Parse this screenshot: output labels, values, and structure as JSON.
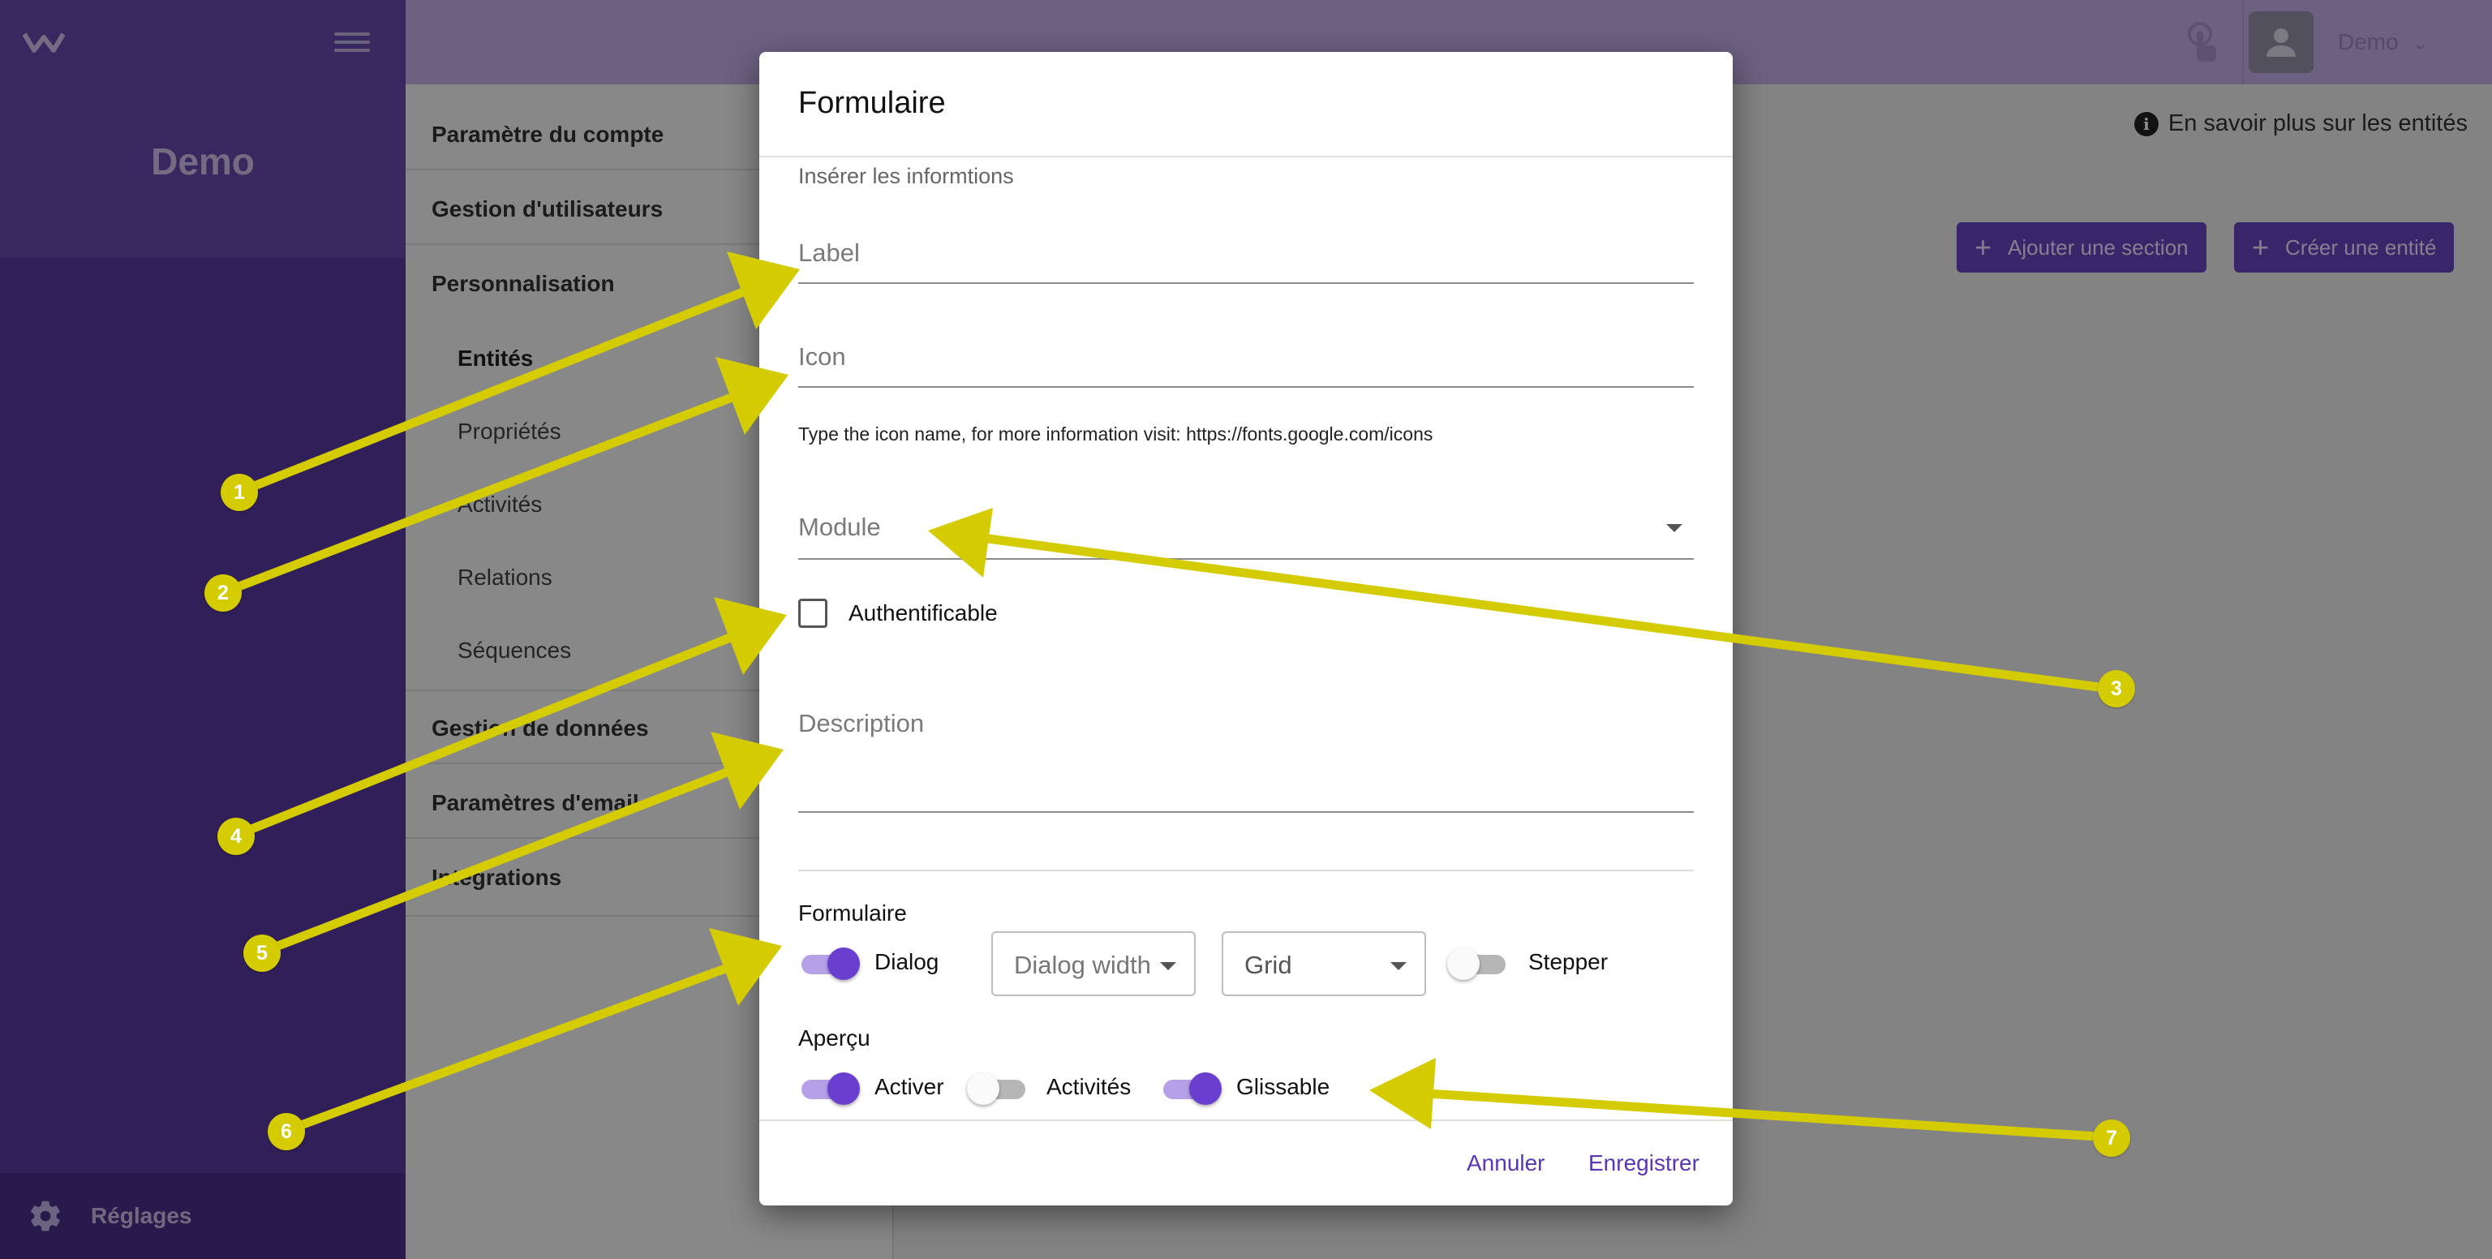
{
  "sidebar": {
    "brand": "Demo",
    "footer_label": "Réglages"
  },
  "topbar": {
    "user_name": "Demo"
  },
  "settings_nav": {
    "account": "Paramètre du compte",
    "users": "Gestion d'utilisateurs",
    "customization": "Personnalisation",
    "entities": "Entités",
    "properties": "Propriétés",
    "activities": "Activités",
    "relations": "Relations",
    "sequences": "Séquences",
    "data": "Gestion de données",
    "email": "Paramètres d'email",
    "integrations": "Intégrations"
  },
  "content": {
    "info_link": "En savoir plus sur les entités",
    "add_section": "Ajouter une section",
    "create_entity": "Créer une entité"
  },
  "dialog": {
    "title": "Formulaire",
    "subtitle": "Insérer les informtions",
    "label_placeholder": "Label",
    "icon_placeholder": "Icon",
    "icon_hint": "Type the icon name, for more information visit: https://fonts.google.com/icons",
    "module_placeholder": "Module",
    "authentificable_label": "Authentificable",
    "authentificable_checked": false,
    "description_placeholder": "Description",
    "form_section": {
      "label": "Formulaire",
      "dialog_label": "Dialog",
      "dialog_on": true,
      "dialog_width_placeholder": "Dialog width",
      "layout_value": "Grid",
      "stepper_label": "Stepper",
      "stepper_on": false
    },
    "preview_section": {
      "label": "Aperçu",
      "activer_label": "Activer",
      "activer_on": true,
      "activites_label": "Activités",
      "activites_on": false,
      "glissable_label": "Glissable",
      "glissable_on": true
    },
    "cancel": "Annuler",
    "save": "Enregistrer"
  },
  "annotations": [
    "1",
    "2",
    "3",
    "4",
    "5",
    "6",
    "7"
  ],
  "colors": {
    "primary": "#5a35b8",
    "sidebar": "#4a2a96",
    "annotation": "#d4cc00"
  }
}
